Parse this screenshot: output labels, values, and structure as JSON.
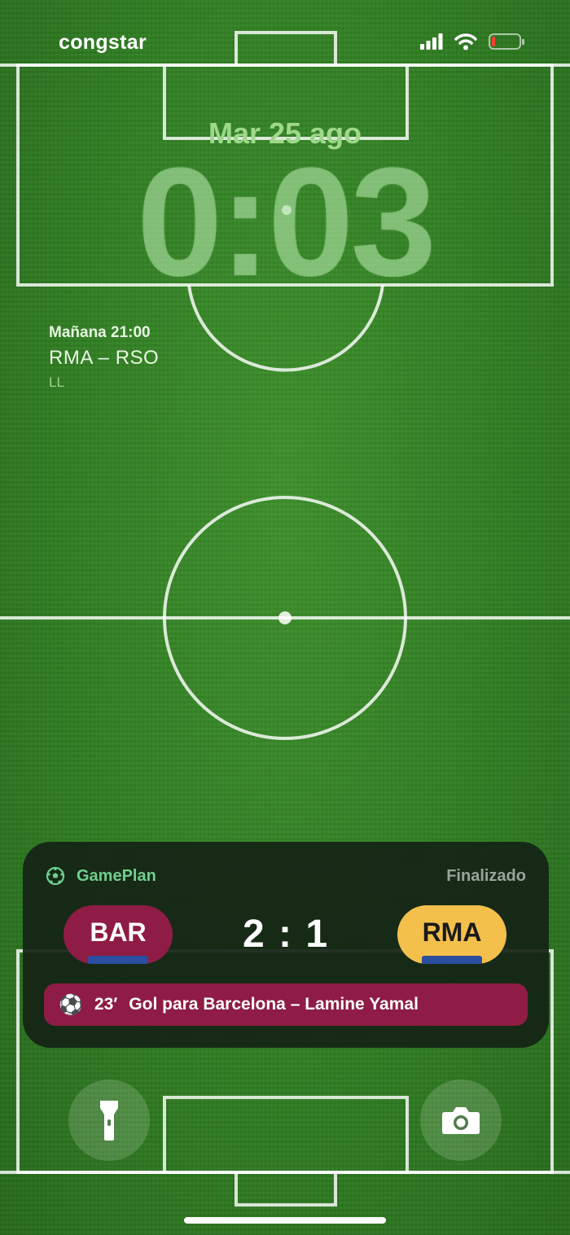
{
  "status_bar": {
    "carrier": "congstar",
    "signal_icon": "cellular-signal-icon",
    "wifi_icon": "wifi-icon",
    "battery_icon": "battery-low-icon",
    "battery_level": 0.12,
    "battery_color": "#ff3b30"
  },
  "lock_screen": {
    "date": "Mar 25 ago",
    "time": "0:03",
    "wallpaper": "soccer-pitch"
  },
  "widget_next_game": {
    "when": "Mañana 21:00",
    "match": "RMA – RSO",
    "league": "LL"
  },
  "live_activity": {
    "app_icon": "soccer-ball-icon",
    "app_name": "GamePlan",
    "status": "Finalizado",
    "home_team": {
      "abbr": "BAR",
      "color": "#8e1c45"
    },
    "away_team": {
      "abbr": "RMA",
      "color": "#f3c04b"
    },
    "score": "2 : 1",
    "event": {
      "icon": "soccer-ball-icon",
      "minute": "23′",
      "text": "Gol para Barcelona – Lamine Yamal"
    }
  },
  "quick_actions": {
    "flashlight_icon": "flashlight-icon",
    "camera_icon": "camera-icon"
  }
}
